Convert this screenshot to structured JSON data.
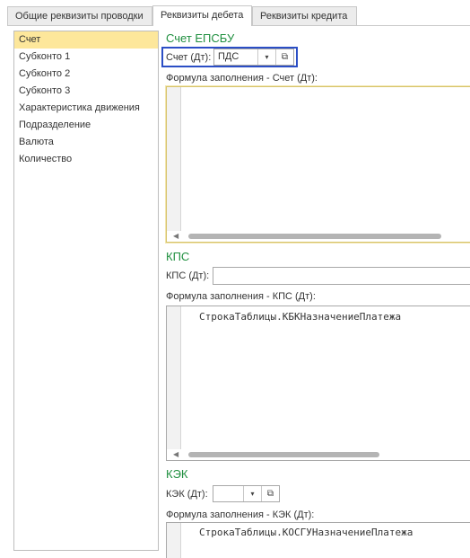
{
  "tabs": [
    "Общие реквизиты проводки",
    "Реквизиты дебета",
    "Реквизиты кредита"
  ],
  "active_tab": 1,
  "fields_list": {
    "items": [
      "Счет",
      "Субконто 1",
      "Субконто 2",
      "Субконто 3",
      "Характеристика движения",
      "Подразделение",
      "Валюта",
      "Количество"
    ],
    "selected": 0
  },
  "account_section": {
    "title": "Счет ЕПСБУ",
    "field_label": "Счет (Дт):",
    "field_value": "ПДС",
    "formula_label": "Формула заполнения - Счет (Дт):",
    "formula_text": ""
  },
  "kps_section": {
    "title": "КПС",
    "field_label": "КПС (Дт):",
    "field_value": "",
    "formula_label": "Формула заполнения - КПС (Дт):",
    "formula_text": "СтрокаТаблицы.КБКНазначениеПлатежа"
  },
  "kek_section": {
    "title": "КЭК",
    "field_label": "КЭК (Дт):",
    "field_value": "",
    "formula_label": "Формула заполнения - КЭК (Дт):",
    "formula_text": "СтрокаТаблицы.КОСГУНазначениеПлатежа"
  },
  "icons": {
    "dropdown": "chevron-down-icon",
    "open": "open-form-icon",
    "scroll_left": "scroll-left-arrow-icon"
  },
  "colors": {
    "section_title": "#1f8f3f",
    "selected_row": "#fde79b",
    "focus_border": "#2b4ec5"
  }
}
